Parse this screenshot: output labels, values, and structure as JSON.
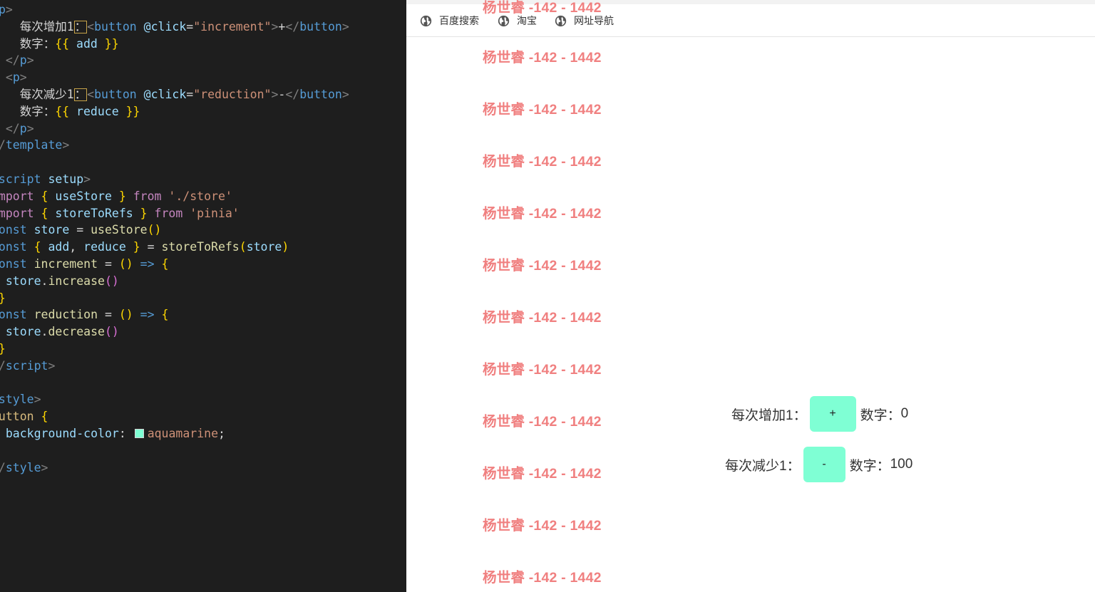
{
  "editor": {
    "lines": [
      {
        "tokens": [
          {
            "t": "<",
            "c": "punc"
          },
          {
            "t": "p",
            "c": "tag"
          },
          {
            "t": ">",
            "c": "punc"
          }
        ]
      },
      {
        "tokens": [
          {
            "t": "    每次增加1",
            "c": "text"
          },
          {
            "t": "：",
            "c": "colonbox"
          },
          {
            "t": "<",
            "c": "punc"
          },
          {
            "t": "button",
            "c": "tag"
          },
          {
            "t": " @click",
            "c": "attr"
          },
          {
            "t": "=",
            "c": "plain"
          },
          {
            "t": "\"increment\"",
            "c": "str"
          },
          {
            "t": ">",
            "c": "punc"
          },
          {
            "t": "+",
            "c": "text"
          },
          {
            "t": "</",
            "c": "punc"
          },
          {
            "t": "button",
            "c": "tag"
          },
          {
            "t": ">",
            "c": "punc"
          }
        ]
      },
      {
        "tokens": [
          {
            "t": "    数字：",
            "c": "text"
          },
          {
            "t": "{{",
            "c": "brace"
          },
          {
            "t": " add ",
            "c": "ident"
          },
          {
            "t": "}}",
            "c": "brace"
          }
        ]
      },
      {
        "tokens": [
          {
            "t": "  </",
            "c": "punc"
          },
          {
            "t": "p",
            "c": "tag"
          },
          {
            "t": ">",
            "c": "punc"
          }
        ]
      },
      {
        "tokens": [
          {
            "t": "  <",
            "c": "punc"
          },
          {
            "t": "p",
            "c": "tag"
          },
          {
            "t": ">",
            "c": "punc"
          }
        ]
      },
      {
        "tokens": [
          {
            "t": "    每次减少1",
            "c": "text"
          },
          {
            "t": "：",
            "c": "colonbox"
          },
          {
            "t": "<",
            "c": "punc"
          },
          {
            "t": "button",
            "c": "tag"
          },
          {
            "t": " @click",
            "c": "attr"
          },
          {
            "t": "=",
            "c": "plain"
          },
          {
            "t": "\"reduction\"",
            "c": "str"
          },
          {
            "t": ">",
            "c": "punc"
          },
          {
            "t": "-",
            "c": "text"
          },
          {
            "t": "</",
            "c": "punc"
          },
          {
            "t": "button",
            "c": "tag"
          },
          {
            "t": ">",
            "c": "punc"
          }
        ]
      },
      {
        "tokens": [
          {
            "t": "    数字：",
            "c": "text"
          },
          {
            "t": "{{",
            "c": "brace"
          },
          {
            "t": " reduce ",
            "c": "ident"
          },
          {
            "t": "}}",
            "c": "brace"
          }
        ]
      },
      {
        "tokens": [
          {
            "t": "  </",
            "c": "punc"
          },
          {
            "t": "p",
            "c": "tag"
          },
          {
            "t": ">",
            "c": "punc"
          }
        ]
      },
      {
        "tokens": [
          {
            "t": " /",
            "c": "punc"
          },
          {
            "t": "template",
            "c": "tag"
          },
          {
            "t": ">",
            "c": "punc"
          }
        ]
      },
      {
        "tokens": []
      },
      {
        "tokens": [
          {
            "t": " script",
            "c": "tag"
          },
          {
            "t": " setup",
            "c": "attr"
          },
          {
            "t": ">",
            "c": "punc"
          }
        ]
      },
      {
        "tokens": [
          {
            "t": " mport",
            "c": "kw"
          },
          {
            "t": " { ",
            "c": "brace"
          },
          {
            "t": "useStore",
            "c": "ident"
          },
          {
            "t": " } ",
            "c": "brace"
          },
          {
            "t": "from",
            "c": "kw"
          },
          {
            "t": " './store'",
            "c": "str"
          }
        ]
      },
      {
        "tokens": [
          {
            "t": " mport",
            "c": "kw"
          },
          {
            "t": " { ",
            "c": "brace"
          },
          {
            "t": "storeToRefs",
            "c": "ident"
          },
          {
            "t": " } ",
            "c": "brace"
          },
          {
            "t": "from",
            "c": "kw"
          },
          {
            "t": " 'pinia'",
            "c": "str"
          }
        ]
      },
      {
        "tokens": [
          {
            "t": " onst",
            "c": "decl"
          },
          {
            "t": " store",
            "c": "ident"
          },
          {
            "t": " = ",
            "c": "plain"
          },
          {
            "t": "useStore",
            "c": "fn"
          },
          {
            "t": "()",
            "c": "brace"
          }
        ]
      },
      {
        "tokens": [
          {
            "t": " onst",
            "c": "decl"
          },
          {
            "t": " { ",
            "c": "brace"
          },
          {
            "t": "add",
            "c": "ident"
          },
          {
            "t": ", ",
            "c": "plain"
          },
          {
            "t": "reduce",
            "c": "ident"
          },
          {
            "t": " } ",
            "c": "brace"
          },
          {
            "t": "= ",
            "c": "plain"
          },
          {
            "t": "storeToRefs",
            "c": "fn"
          },
          {
            "t": "(",
            "c": "brace"
          },
          {
            "t": "store",
            "c": "ident"
          },
          {
            "t": ")",
            "c": "brace"
          }
        ]
      },
      {
        "tokens": [
          {
            "t": " onst",
            "c": "decl"
          },
          {
            "t": " increment",
            "c": "fn"
          },
          {
            "t": " = ",
            "c": "plain"
          },
          {
            "t": "()",
            "c": "brace"
          },
          {
            "t": " => ",
            "c": "decl"
          },
          {
            "t": "{",
            "c": "brace"
          }
        ]
      },
      {
        "tokens": [
          {
            "t": "  store",
            "c": "ident"
          },
          {
            "t": ".",
            "c": "plain"
          },
          {
            "t": "increase",
            "c": "fn"
          },
          {
            "t": "()",
            "c": "paren2"
          }
        ]
      },
      {
        "tokens": [
          {
            "t": " }",
            "c": "brace"
          }
        ]
      },
      {
        "tokens": [
          {
            "t": " onst",
            "c": "decl"
          },
          {
            "t": " reduction",
            "c": "fn"
          },
          {
            "t": " = ",
            "c": "plain"
          },
          {
            "t": "()",
            "c": "brace"
          },
          {
            "t": " => ",
            "c": "decl"
          },
          {
            "t": "{",
            "c": "brace"
          }
        ]
      },
      {
        "tokens": [
          {
            "t": "  store",
            "c": "ident"
          },
          {
            "t": ".",
            "c": "plain"
          },
          {
            "t": "decrease",
            "c": "fn"
          },
          {
            "t": "()",
            "c": "paren2"
          }
        ]
      },
      {
        "tokens": [
          {
            "t": " }",
            "c": "brace"
          }
        ]
      },
      {
        "tokens": [
          {
            "t": " /",
            "c": "punc"
          },
          {
            "t": "script",
            "c": "tag"
          },
          {
            "t": ">",
            "c": "punc"
          }
        ]
      },
      {
        "tokens": []
      },
      {
        "tokens": [
          {
            "t": " style",
            "c": "tag"
          },
          {
            "t": ">",
            "c": "punc"
          }
        ]
      },
      {
        "tokens": [
          {
            "t": " utton",
            "c": "sel"
          },
          {
            "t": " {",
            "c": "brace"
          }
        ]
      },
      {
        "tokens": [
          {
            "t": "  background-color",
            "c": "prop"
          },
          {
            "t": ": ",
            "c": "plain"
          },
          {
            "t": "",
            "c": "swatch"
          },
          {
            "t": "aquamarine",
            "c": "val"
          },
          {
            "t": ";",
            "c": "plain"
          }
        ]
      },
      {
        "tokens": []
      },
      {
        "tokens": [
          {
            "t": " /",
            "c": "punc"
          },
          {
            "t": "style",
            "c": "tag"
          },
          {
            "t": ">",
            "c": "punc"
          }
        ]
      }
    ]
  },
  "browser": {
    "bookmarks": [
      {
        "label": "百度搜索",
        "icon": "globe-icon"
      },
      {
        "label": "淘宝",
        "icon": "globe-icon"
      },
      {
        "label": "网址导航",
        "icon": "globe-icon"
      }
    ],
    "watermark_text": "杨世睿 -142 - 1442",
    "demo": {
      "increase_label": "每次增加1：",
      "increase_button": "+",
      "increase_count_label": "数字：",
      "increase_count_value": "0",
      "decrease_label": "每次减少1：",
      "decrease_button": "-",
      "decrease_count_label": "数字：",
      "decrease_count_value": "100",
      "button_color": "#7fffd4"
    }
  }
}
